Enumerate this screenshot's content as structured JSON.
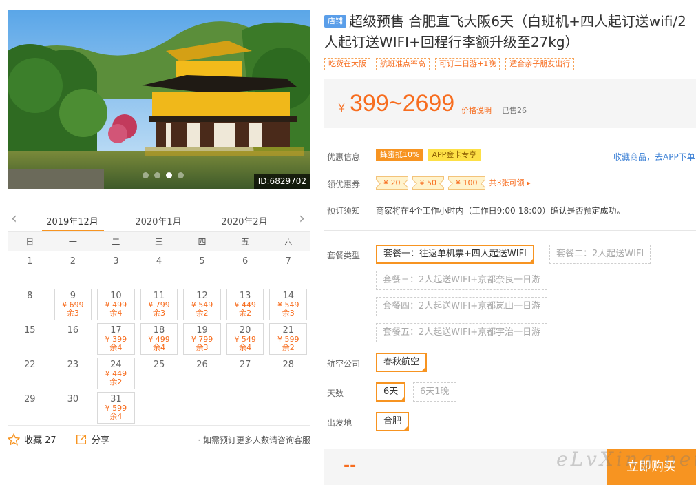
{
  "gallery": {
    "id_label": "ID:6829702",
    "dots_count": 4,
    "active_dot": 3
  },
  "calendar": {
    "months": [
      "2019年12月",
      "2020年1月",
      "2020年2月"
    ],
    "weekdays": [
      "日",
      "一",
      "二",
      "三",
      "四",
      "五",
      "六"
    ],
    "days": [
      {
        "d": "1"
      },
      {
        "d": "2"
      },
      {
        "d": "3"
      },
      {
        "d": "4"
      },
      {
        "d": "5"
      },
      {
        "d": "6"
      },
      {
        "d": "7"
      },
      {
        "d": "8"
      },
      {
        "d": "9",
        "price": "¥ 699",
        "left": "余3"
      },
      {
        "d": "10",
        "price": "¥ 499",
        "left": "余4"
      },
      {
        "d": "11",
        "price": "¥ 799",
        "left": "余3"
      },
      {
        "d": "12",
        "price": "¥ 549",
        "left": "余2"
      },
      {
        "d": "13",
        "price": "¥ 449",
        "left": "余2"
      },
      {
        "d": "14",
        "price": "¥ 549",
        "left": "余3"
      },
      {
        "d": "15"
      },
      {
        "d": "16"
      },
      {
        "d": "17",
        "price": "¥ 399",
        "left": "余4"
      },
      {
        "d": "18",
        "price": "¥ 499",
        "left": "余4"
      },
      {
        "d": "19",
        "price": "¥ 799",
        "left": "余3"
      },
      {
        "d": "20",
        "price": "¥ 549",
        "left": "余4"
      },
      {
        "d": "21",
        "price": "¥ 599",
        "left": "余2"
      },
      {
        "d": "22"
      },
      {
        "d": "23"
      },
      {
        "d": "24",
        "price": "¥ 449",
        "left": "余2"
      },
      {
        "d": "25"
      },
      {
        "d": "26"
      },
      {
        "d": "27"
      },
      {
        "d": "28"
      },
      {
        "d": "29"
      },
      {
        "d": "30"
      },
      {
        "d": "31",
        "price": "¥ 599",
        "left": "余4"
      }
    ]
  },
  "actions": {
    "favorite_label": "收藏 27",
    "share_label": "分享",
    "hint": "· 如需预订更多人数请咨询客服"
  },
  "product": {
    "shop_tag": "店铺",
    "title": "超级预售 合肥直飞大阪6天（白班机+四人起订送wifi/2人起订送WIFI+回程行李额升级至27kg）",
    "tags": [
      "吃货在大阪",
      "航班准点率高",
      "可订二日游+1晚",
      "适合亲子朋友出行"
    ]
  },
  "price": {
    "currency": "¥",
    "range": "399~2699",
    "explain": "价格说明",
    "sold": "已售26"
  },
  "promo": {
    "label": "优惠信息",
    "badge1": "蜂蜜抵10%",
    "badge2": "APP金卡专享",
    "fav_app": "收藏商品，去APP下单"
  },
  "coupons": {
    "label": "领优惠券",
    "items": [
      "¥ 20",
      "¥ 50",
      "¥ 100"
    ],
    "more": "共3张可领 ▸"
  },
  "notice": {
    "label": "预订须知",
    "text": "商家将在4个工作小时内（工作日9:00-18:00）确认是否预定成功。"
  },
  "packages": {
    "label": "套餐类型",
    "items": [
      "套餐一：往返单机票+四人起送WIFI",
      "套餐二：2人起送WIFI",
      "套餐三：2人起送WIFI+京都奈良一日游",
      "套餐四：2人起送WIFI+京都岚山一日游",
      "套餐五：2人起送WIFI+京都宇治一日游"
    ]
  },
  "airline": {
    "label": "航空公司",
    "value": "春秋航空"
  },
  "days": {
    "label": "天数",
    "options": [
      "6天",
      "6天1晚"
    ]
  },
  "departure": {
    "label": "出发地",
    "value": "合肥"
  },
  "buy": {
    "price_placeholder": "--",
    "button": "立即购买",
    "watermark": "eLvXing.net"
  },
  "colors": {
    "accent": "#f79421",
    "price": "#f76d1f",
    "link": "#3a7fd5",
    "shop_tag": "#5a9ee9"
  }
}
